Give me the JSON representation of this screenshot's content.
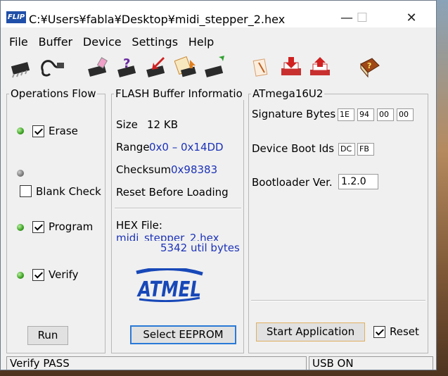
{
  "window": {
    "title": "C:¥Users¥fabla¥Desktop¥midi_stepper_2.hex",
    "app_icon_text": "FLIP"
  },
  "title_controls": {
    "minimize": "—",
    "maximize": "☐",
    "close": "✕"
  },
  "menu": [
    "File",
    "Buffer",
    "Device",
    "Settings",
    "Help"
  ],
  "toolbar": [
    {
      "icon": "select-device-icon"
    },
    {
      "icon": "usb-communication-icon"
    },
    {
      "icon": "erase-icon"
    },
    {
      "icon": "blank-check-icon"
    },
    {
      "icon": "program-icon"
    },
    {
      "icon": "read-icon"
    },
    {
      "icon": "verify-icon"
    },
    {
      "icon": "load-hex-icon"
    },
    {
      "icon": "save-buffer-icon"
    },
    {
      "icon": "load-buffer-icon"
    },
    {
      "icon": "help-book-icon"
    }
  ],
  "operations": {
    "title": "Operations Flow",
    "items": [
      {
        "label": "Erase",
        "checked": true,
        "led": "on"
      },
      {
        "label": "Blank Check",
        "checked": false,
        "led": "off"
      },
      {
        "label": "Program",
        "checked": true,
        "led": "on"
      },
      {
        "label": "Verify",
        "checked": true,
        "led": "on"
      }
    ],
    "run_label": "Run"
  },
  "flash": {
    "title": "FLASH Buffer Informatio",
    "size_label": "Size",
    "size_value": "12 KB",
    "range_label": "Range",
    "range_value": "0x0 – 0x14DD",
    "checksum_label": "Checksum",
    "checksum_value": "0x98383",
    "reset_label": "Reset Before Loading",
    "hex_label": "HEX File:",
    "hex_name": "midi_stepper_2.hex",
    "util_bytes": "5342 util bytes",
    "logo_text": "ATMEL",
    "select_eeprom_label": "Select EEPROM"
  },
  "device": {
    "title": "ATmega16U2",
    "sig_label": "Signature Bytes",
    "sig_bytes": [
      "1E",
      "94",
      "00",
      "00"
    ],
    "boot_ids_label": "Device Boot Ids",
    "boot_ids": [
      "DC",
      "FB"
    ],
    "bootloader_label": "Bootloader Ver.",
    "bootloader_value": "1.2.0",
    "start_app_label": "Start Application",
    "reset_label": "Reset",
    "reset_checked": true
  },
  "status": {
    "left": "Verify PASS",
    "right": "USB ON"
  },
  "colors": {
    "value_blue": "#1c32b8",
    "led_green": "#3aa020",
    "atmel_blue": "#1848b8"
  }
}
